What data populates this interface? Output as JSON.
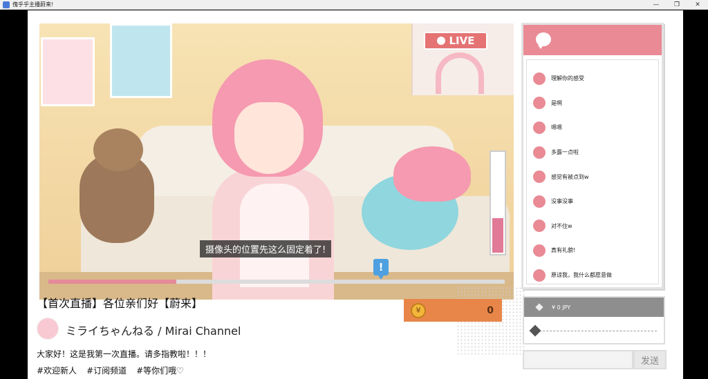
{
  "window": {
    "title": "傀乎乎主播蔚来!"
  },
  "stream": {
    "live_label": "LIVE",
    "subtitle": "摄像头的位置先这么固定着了!",
    "marker_glyph": "!",
    "progress": 0.28,
    "meter_level": 0.34
  },
  "info": {
    "title": "【首次直播】各位亲们好【蔚来】",
    "channel_name": "ミライちゃんねる / Mirai Channel",
    "description": "大家好！这是我第一次直播。请多指教啦！！！",
    "tags": [
      "#欢迎新人",
      "#订阅频道",
      "#等你们哦♡"
    ]
  },
  "coins": {
    "icon_glyph": "¥",
    "value": "0"
  },
  "chat": {
    "messages": [
      "理解你的感受",
      "是啊",
      "嗯嗯",
      "多露一点啦",
      "感觉有被点到w",
      "没事没事",
      "对不住w",
      "真有礼貌!",
      "原谅我，我什么都愿意做"
    ]
  },
  "tip": {
    "label": "¥ 0 JPY"
  },
  "send": {
    "button_label": "发送",
    "input_value": ""
  },
  "colors": {
    "accent_pink": "#e98a95",
    "coin_orange": "#e8864a"
  }
}
